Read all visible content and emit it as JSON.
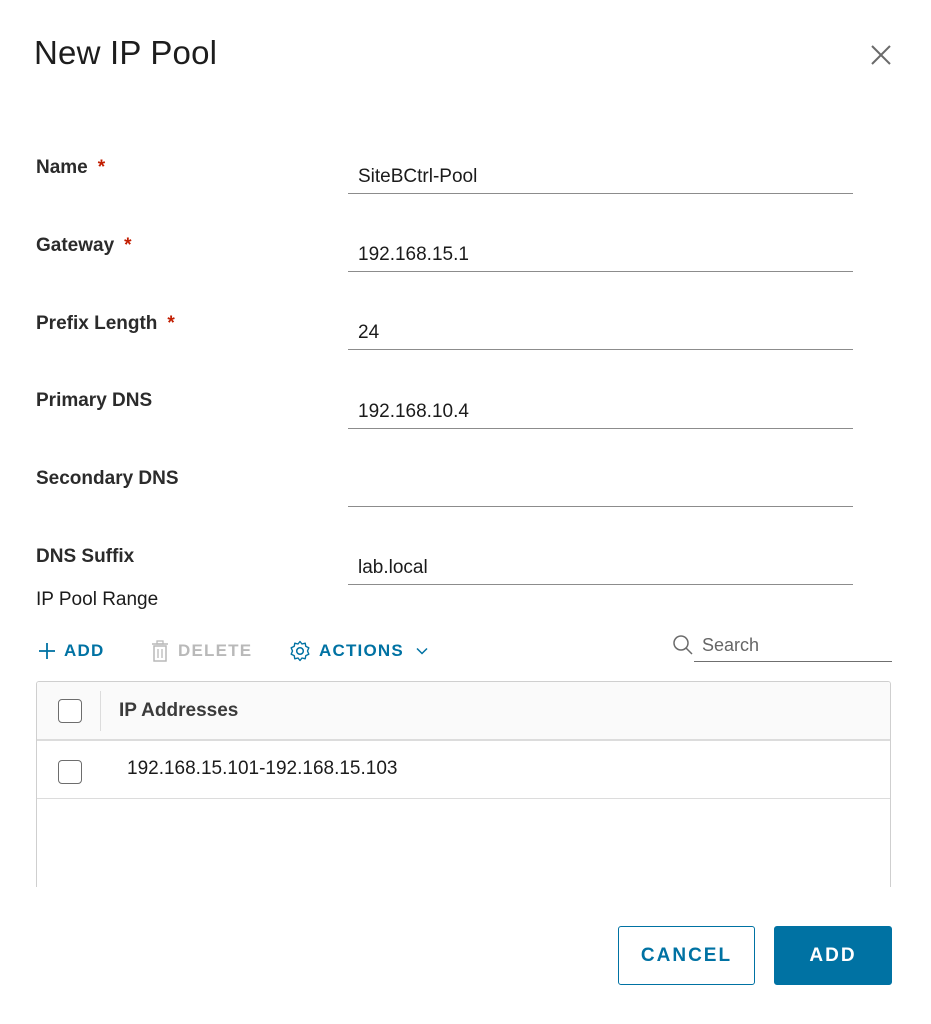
{
  "dialog": {
    "title": "New IP Pool",
    "close_icon": "close-icon"
  },
  "form": {
    "name": {
      "label": "Name",
      "required_mark": "*",
      "value": "SiteBCtrl-Pool"
    },
    "gateway": {
      "label": "Gateway",
      "required_mark": "*",
      "value": "192.168.15.1"
    },
    "prefix_length": {
      "label": "Prefix Length",
      "required_mark": "*",
      "value": "24"
    },
    "primary_dns": {
      "label": "Primary DNS",
      "value": "192.168.10.4"
    },
    "secondary_dns": {
      "label": "Secondary DNS",
      "value": ""
    },
    "dns_suffix": {
      "label": "DNS Suffix",
      "value": "lab.local"
    }
  },
  "ip_pool_range": {
    "label": "IP Pool Range",
    "toolbar": {
      "add_label": "ADD",
      "add_icon": "plus-icon",
      "delete_label": "DELETE",
      "delete_icon": "trash-icon",
      "actions_label": "ACTIONS",
      "actions_icon": "gear-icon",
      "actions_chevron": "chevron-down-icon"
    },
    "search": {
      "placeholder": "Search",
      "icon": "search-icon"
    },
    "grid": {
      "columns": [
        "IP Addresses"
      ],
      "rows": [
        {
          "ip_addresses": "192.168.15.101-192.168.15.103"
        }
      ]
    }
  },
  "footer": {
    "cancel_label": "CANCEL",
    "add_label": "ADD"
  },
  "colors": {
    "accent": "#0072a3",
    "required": "#c21d00",
    "disabled": "#b9b9b9"
  }
}
